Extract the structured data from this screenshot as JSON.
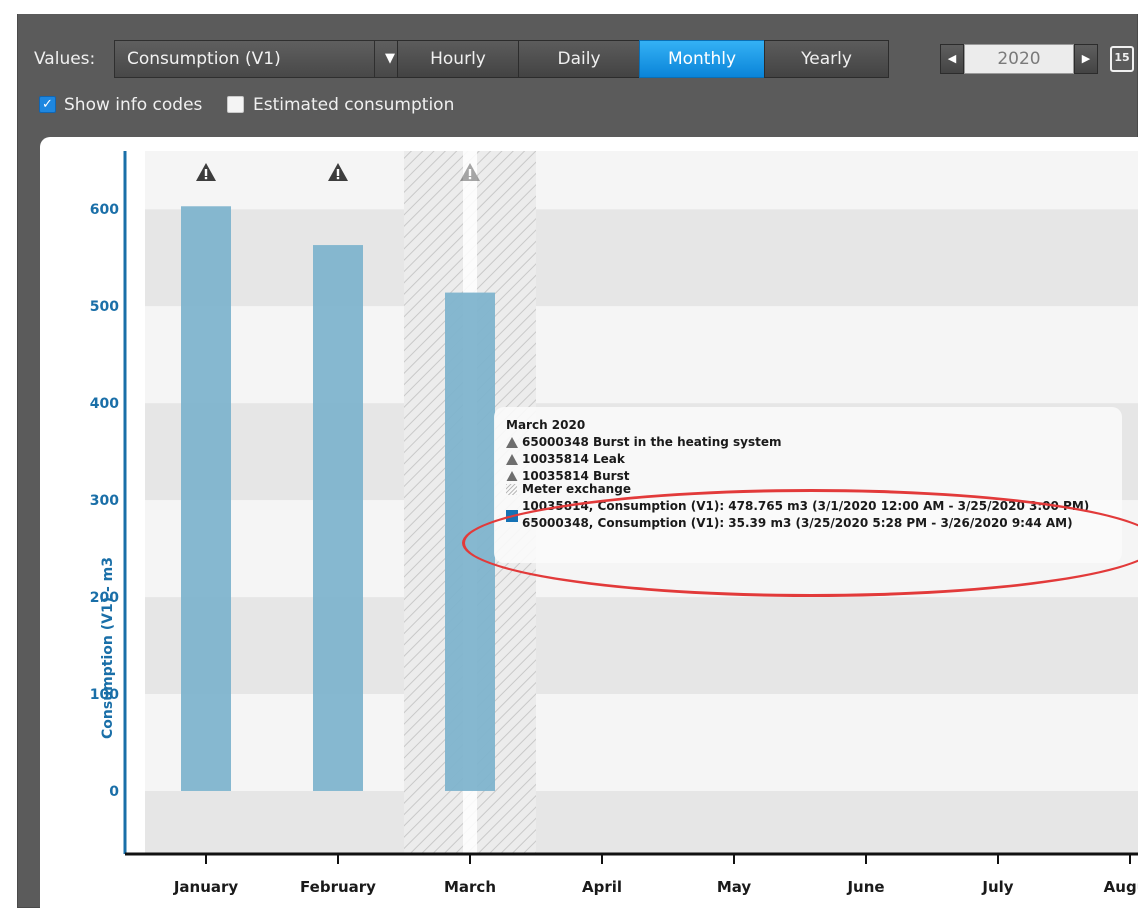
{
  "toolbar": {
    "values_label": "Values:",
    "values_select": "Consumption (V1)",
    "periods": [
      "Hourly",
      "Daily",
      "Monthly",
      "Yearly"
    ],
    "active_period": "Monthly",
    "year": "2020",
    "calendar_icon_text": "15"
  },
  "options": {
    "show_info_codes": {
      "label": "Show info codes",
      "checked": true
    },
    "estimated_consumption": {
      "label": "Estimated consumption",
      "checked": false
    }
  },
  "chart_data": {
    "type": "bar",
    "ylabel": "Consumption (V1) - m3",
    "categories": [
      "January",
      "February",
      "March",
      "April",
      "May",
      "June",
      "July",
      "Augus"
    ],
    "values": [
      603,
      563,
      514,
      null,
      null,
      null,
      null,
      null
    ],
    "y_ticks": [
      0,
      100,
      200,
      300,
      400,
      500,
      600
    ],
    "ylim": [
      -65,
      660
    ],
    "info_code_markers": [
      "January",
      "February",
      "March"
    ],
    "meter_exchange_month": "March",
    "bar_color": "#7fb4cd",
    "axis_color": "#1a6fa8"
  },
  "tooltip": {
    "title": "March 2020",
    "lines": [
      "65000348 Burst in the heating system",
      "10035814 Leak",
      "10035814 Burst",
      "Meter exchange",
      "10035814, Consumption (V1): 478.765 m3 (3/1/2020 12:00 AM - 3/25/2020 3:00 PM)",
      "65000348, Consumption (V1): 35.39 m3 (3/25/2020 5:28 PM - 3/26/2020 9:44 AM)"
    ]
  },
  "colors": {
    "accent": "#1e87e0",
    "highlight_oval": "#e23a3a"
  }
}
